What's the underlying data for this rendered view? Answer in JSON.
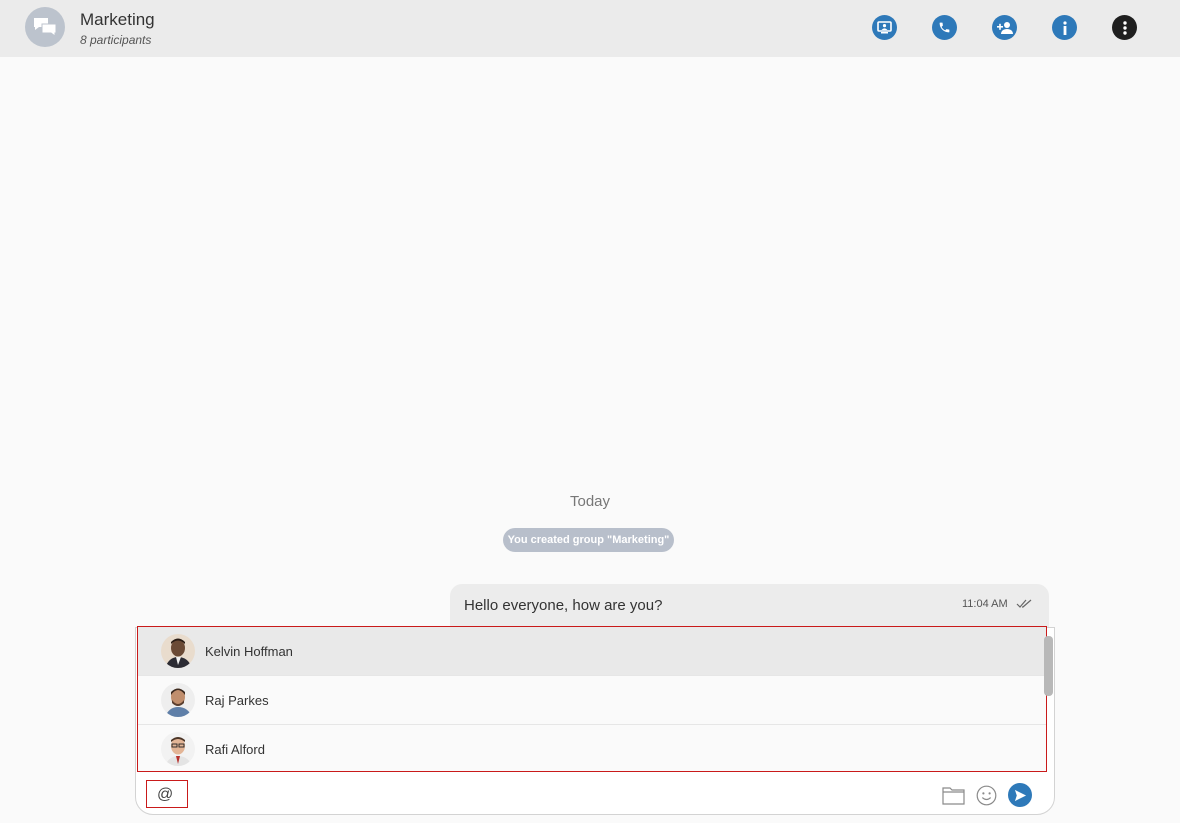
{
  "header": {
    "title": "Marketing",
    "participants": "8 participants",
    "actions": [
      "screen-share-icon",
      "phone-icon",
      "add-user-icon",
      "info-icon",
      "more-vertical-icon"
    ]
  },
  "chat": {
    "date_separator": "Today",
    "system_message": "You created group \"Marketing\"",
    "messages": [
      {
        "text": "Hello everyone, how are you?",
        "time": "11:04 AM",
        "status": "read"
      }
    ]
  },
  "mention_suggestions": [
    {
      "name": "Kelvin Hoffman",
      "selected": true
    },
    {
      "name": "Raj Parkes",
      "selected": false
    },
    {
      "name": "Rafi Alford",
      "selected": false
    }
  ],
  "composer": {
    "value": "@"
  },
  "colors": {
    "accent": "#2e79b9",
    "header_bg": "#ebebeb",
    "pill_bg": "#b8bfcb",
    "highlight_border": "#c91a1a"
  }
}
